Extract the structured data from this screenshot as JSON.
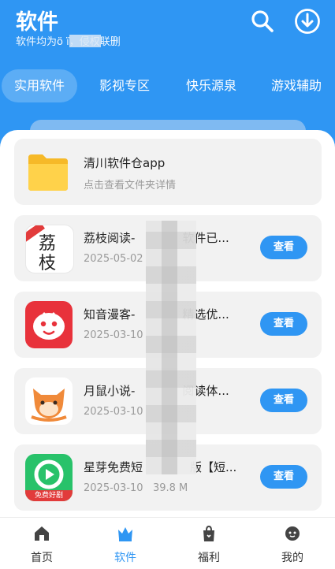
{
  "header": {
    "title": "软件",
    "subtitle": "软件均为ö       ï，侵权联删",
    "icons": [
      "search-icon",
      "download-icon"
    ]
  },
  "tabs": [
    {
      "label": "实用软件",
      "active": true
    },
    {
      "label": "影视专区",
      "active": false
    },
    {
      "label": "快乐源泉",
      "active": false
    },
    {
      "label": "游戏辅助",
      "active": false
    }
  ],
  "folder": {
    "title": "清川软件仓app",
    "subtitle": "点击查看文件夹详情"
  },
  "apps": [
    {
      "name": "荔枝阅读-",
      "name_tail": "软件已...",
      "date": "2025-05-02",
      "size": "",
      "button": "查看"
    },
    {
      "name": "知音漫客-",
      "name_tail": "精选优...",
      "date": "2025-03-10",
      "size": "",
      "button": "查看"
    },
    {
      "name": "月鼠小说-",
      "name_tail": "阅读体...",
      "date": "2025-03-10",
      "size": "",
      "button": "查看"
    },
    {
      "name": "星芽免费短",
      "name_tail": "版【短...",
      "date": "2025-03-10",
      "size": "39.8 M",
      "button": "查看"
    }
  ],
  "app_icons": {
    "lizhi_text_top": "荔",
    "lizhi_text_bottom": "枝",
    "xingya_badge": "免费好剧"
  },
  "nav": [
    {
      "label": "首页",
      "active": false
    },
    {
      "label": "软件",
      "active": true
    },
    {
      "label": "福利",
      "active": false
    },
    {
      "label": "我的",
      "active": false
    }
  ],
  "colors": {
    "accent": "#2f96f3"
  }
}
